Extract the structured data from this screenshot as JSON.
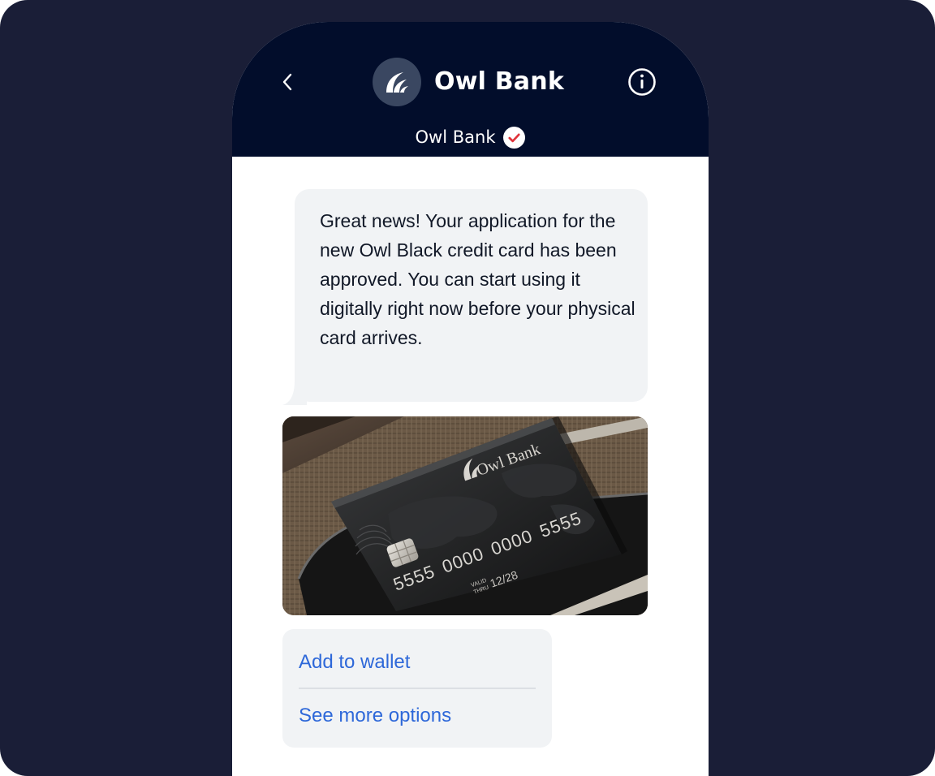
{
  "header": {
    "title": "Owl Bank",
    "subtitle": "Owl Bank",
    "back_icon": "chevron-left-icon",
    "info_icon": "info-icon",
    "logo_icon": "owl-bank-logo",
    "verified_icon": "verified-check-icon"
  },
  "message": {
    "text": "Great news! Your application for the new Owl Black credit card has been approved. You can start using it digitally right now before your physical card arrives."
  },
  "card_image": {
    "brand": "Owl Bank",
    "number_groups": [
      "5555",
      "0000",
      "0000",
      "5555"
    ],
    "valid_label_1": "VALID",
    "valid_label_2": "THRU",
    "expiry": "12/28"
  },
  "actions": {
    "add_wallet": "Add to wallet",
    "more_options": "See more options"
  },
  "colors": {
    "background": "#1a1e37",
    "header": "#020d2b",
    "bubble": "#f1f3f5",
    "link": "#2e68d9",
    "verified": "#e0343b"
  }
}
